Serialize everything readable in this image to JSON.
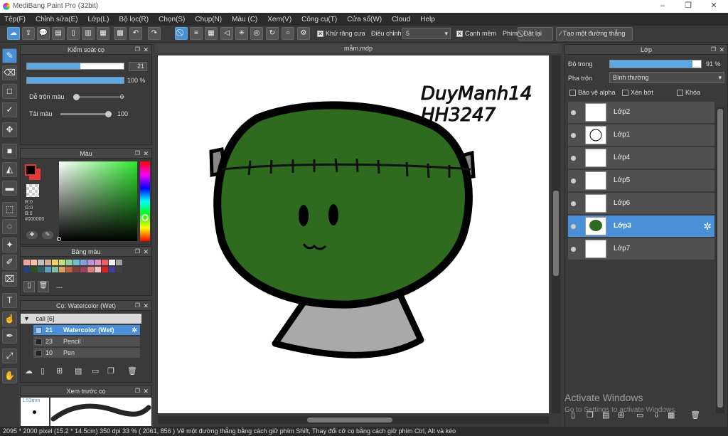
{
  "app": {
    "title": "MediBang Paint Pro (32bit)",
    "minimize": "–",
    "maximize": "❐",
    "close": "✕"
  },
  "menu": [
    "Tệp(F)",
    "Chỉnh sửa(E)",
    "Lớp(L)",
    "Bộ lọc(R)",
    "Chọn(S)",
    "Chụp(N)",
    "Màu (C)",
    "Xem(V)",
    "Công cụ(T)",
    "Cửa sổ(W)",
    "Cloud",
    "Help"
  ],
  "toolbar": {
    "antialias_label": "Khử răng cưa",
    "adjust_label": "Điều chỉnh",
    "adjust_value": "5",
    "soft_label": "Cạnh mềm",
    "key_label": "Phím",
    "reset_label": "Đặt lại",
    "straight_label": "Tạo một đường thẳng"
  },
  "brush_control": {
    "title": "Kiểm soát cọ",
    "size_value": "21",
    "size_fill": 0.55,
    "opacity_value": "100 %",
    "opacity_fill": 1.0,
    "blend_label": "Dễ trộn màu",
    "blend_value": "0",
    "refill_label": "Tải màu",
    "refill_value": "100"
  },
  "color_panel": {
    "title": "Màu",
    "r": "R:0",
    "g": "G:0",
    "b": "B:0",
    "hex": "#000000",
    "fg": "#000000",
    "bg": "#e53935"
  },
  "palette": {
    "title": "Bảng màu",
    "more": "---",
    "swatches": [
      "#f2a0a0",
      "#f8c0a8",
      "#c0c0c0",
      "#d0b090",
      "#f0d060",
      "#c0e080",
      "#90d0a0",
      "#70c0d0",
      "#80a0e0",
      "#c090e0",
      "#e090c0",
      "#f06060",
      "#f0f0f0",
      "#a0a0a0",
      "#204080",
      "#305020",
      "#306060",
      "#60a0c0",
      "#80c0a0",
      "#e0a060",
      "#c06040",
      "#804040",
      "#a04060",
      "#e08080",
      "#f0c0c0",
      "#e02020",
      "#4040a0",
      "#404040"
    ]
  },
  "brush_list": {
    "title": "Cọ: Watercolor (Wet)",
    "group": "cali [6]",
    "items": [
      {
        "num": "21",
        "label": "Watercolor (Wet)",
        "selected": true
      },
      {
        "num": "23",
        "label": "Pencil",
        "selected": false
      },
      {
        "num": "10",
        "label": "Pen",
        "selected": false
      }
    ]
  },
  "preview": {
    "title": "Xem trước cọ",
    "size": "1.53mm"
  },
  "document": {
    "tab": "mẫm.mdp",
    "signature": "DuyManh14\nHH3247"
  },
  "layers": {
    "title": "Lớp",
    "opacity_label": "Độ trong",
    "opacity_value": "91 %",
    "opacity_fill": 0.91,
    "blend_label": "Pha trộn",
    "blend_value": "Bình thường",
    "protect_alpha": "Bảo vệ alpha",
    "clipping": "Xén bớt",
    "lock": "Khóa",
    "items": [
      {
        "name": "Lớp2",
        "selected": false
      },
      {
        "name": "Lớp1",
        "selected": false
      },
      {
        "name": "Lớp4",
        "selected": false
      },
      {
        "name": "Lớp5",
        "selected": false
      },
      {
        "name": "Lớp6",
        "selected": false
      },
      {
        "name": "Lớp3",
        "selected": true
      },
      {
        "name": "Lớp7",
        "selected": false
      }
    ]
  },
  "watermark": {
    "line1": "Activate Windows",
    "line2": "Go to Settings to activate Windows."
  },
  "status": "2095 * 2000 pixel   (15.2 * 14.5cm)   350 dpi   33 %   ( 2061, 856 )   Vẽ một đường thẳng bằng cách giữ phím Shift, Thay đổi cỡ cọ bằng cách giữ phím Ctrl, Alt và kéo"
}
